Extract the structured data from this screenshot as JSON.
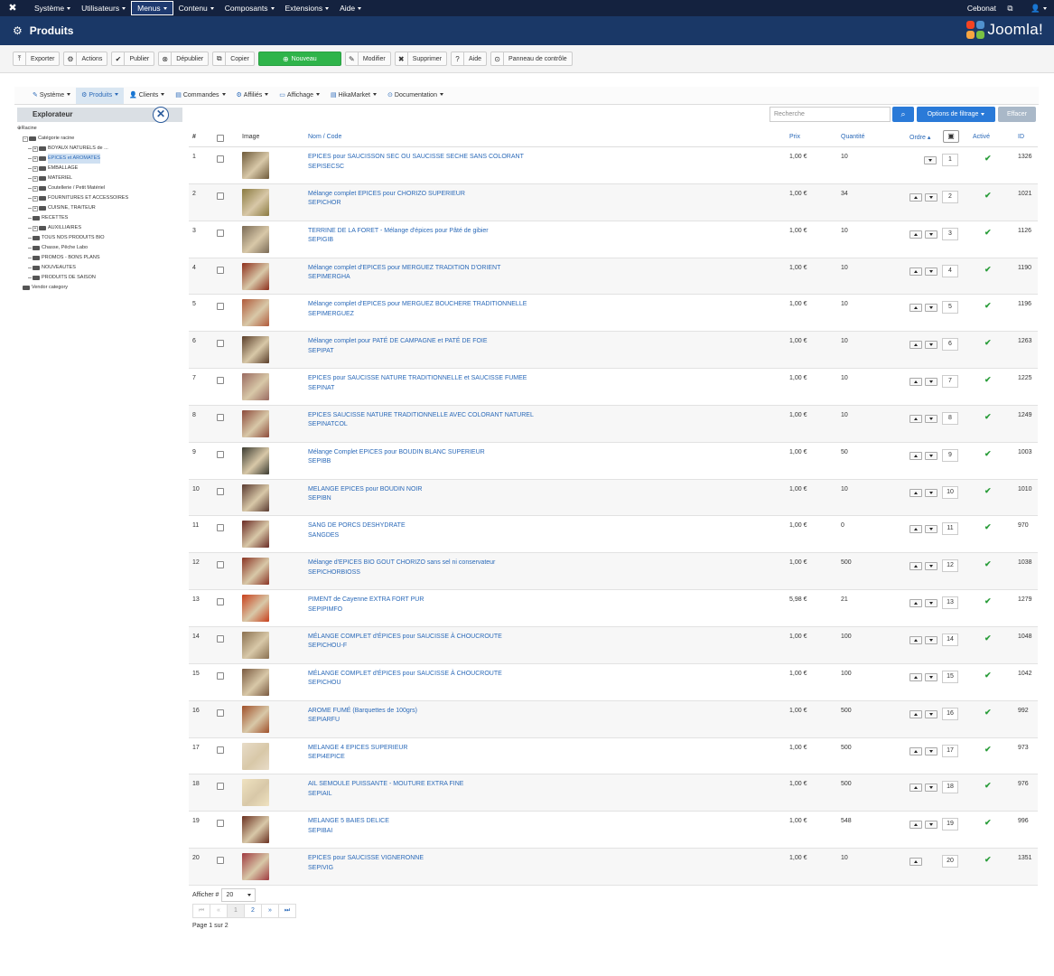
{
  "topnav": {
    "items": [
      {
        "label": "Système",
        "active": false
      },
      {
        "label": "Utilisateurs",
        "active": false
      },
      {
        "label": "Menus",
        "active": true
      },
      {
        "label": "Contenu",
        "active": false
      },
      {
        "label": "Composants",
        "active": false
      },
      {
        "label": "Extensions",
        "active": false
      },
      {
        "label": "Aide",
        "active": false
      }
    ],
    "site": "Cebonat",
    "user_glyph": "👤"
  },
  "title": "Produits",
  "brand": "Joomla!",
  "toolbar": [
    {
      "label": "Exporter",
      "icon": "⤒",
      "icon_name": "export-icon"
    },
    {
      "label": "Actions",
      "icon": "⚙",
      "icon_name": "actions-icon"
    },
    {
      "label": "Publier",
      "icon": "✔",
      "icon_name": "publish-icon"
    },
    {
      "label": "Dépublier",
      "icon": "⊗",
      "icon_name": "unpublish-icon"
    },
    {
      "label": "Copier",
      "icon": "⧉",
      "icon_name": "copy-icon"
    },
    {
      "label": "Nouveau",
      "icon": "⊕",
      "icon_name": "new-icon",
      "primary": true
    },
    {
      "label": "Modifier",
      "icon": "✎",
      "icon_name": "edit-icon"
    },
    {
      "label": "Supprimer",
      "icon": "✖",
      "icon_name": "delete-icon"
    },
    {
      "label": "Aide",
      "icon": "?",
      "icon_name": "help-icon"
    },
    {
      "label": "Panneau de contrôle",
      "icon": "⊙",
      "icon_name": "control-panel-icon"
    }
  ],
  "hikanav": [
    {
      "label": "Système",
      "icon": "✎",
      "icon_name": "wrench-icon",
      "active": false
    },
    {
      "label": "Produits",
      "icon": "⚙",
      "icon_name": "products-icon",
      "active": true
    },
    {
      "label": "Clients",
      "icon": "👤",
      "icon_name": "clients-icon",
      "active": false
    },
    {
      "label": "Commandes",
      "icon": "▤",
      "icon_name": "orders-icon",
      "active": false
    },
    {
      "label": "Affiliés",
      "icon": "⚙",
      "icon_name": "affiliates-icon",
      "active": false
    },
    {
      "label": "Affichage",
      "icon": "▭",
      "icon_name": "display-icon",
      "active": false
    },
    {
      "label": "HikaMarket",
      "icon": "▤",
      "icon_name": "hikamarket-icon",
      "active": false
    },
    {
      "label": "Documentation",
      "icon": "⊙",
      "icon_name": "documentation-icon",
      "active": false
    }
  ],
  "explorer": {
    "title": "Explorateur",
    "tree": [
      {
        "label": "Racine",
        "indent": 0,
        "exp": "",
        "selected": false
      },
      {
        "label": "Catégorie racine",
        "indent": 1,
        "exp": "−",
        "selected": false
      },
      {
        "label": "BOYAUX NATURELS de ...",
        "indent": 2,
        "exp": "+",
        "selected": false
      },
      {
        "label": "EPICES et AROMATES",
        "indent": 2,
        "exp": "+",
        "selected": true
      },
      {
        "label": "EMBALLAGE",
        "indent": 2,
        "exp": "+",
        "selected": false
      },
      {
        "label": "MATERIEL",
        "indent": 2,
        "exp": "+",
        "selected": false
      },
      {
        "label": "Coutellerie / Petit Matériel",
        "indent": 2,
        "exp": "+",
        "selected": false
      },
      {
        "label": "FOURNITURES ET ACCESSOIRES",
        "indent": 2,
        "exp": "+",
        "selected": false
      },
      {
        "label": "CUISINE, TRAITEUR",
        "indent": 2,
        "exp": "+",
        "selected": false
      },
      {
        "label": "RECETTES",
        "indent": 2,
        "exp": "",
        "selected": false
      },
      {
        "label": "AUXILLIAIRES",
        "indent": 2,
        "exp": "+",
        "selected": false
      },
      {
        "label": "TOUS NOS PRODUITS BIO",
        "indent": 2,
        "exp": "",
        "selected": false
      },
      {
        "label": "Chasse, Pêche Labo",
        "indent": 2,
        "exp": "",
        "selected": false
      },
      {
        "label": "PROMOS - BONS PLANS",
        "indent": 2,
        "exp": "",
        "selected": false
      },
      {
        "label": "NOUVEAUTES",
        "indent": 2,
        "exp": "",
        "selected": false
      },
      {
        "label": "PRODUITS DE SAISON",
        "indent": 2,
        "exp": "",
        "selected": false
      },
      {
        "label": "Vendor category",
        "indent": 1,
        "exp": "",
        "selected": false
      }
    ]
  },
  "filter": {
    "search_placeholder": "Recherche",
    "options_label": "Options de filtrage",
    "clear_label": "Effacer"
  },
  "table": {
    "headers": {
      "num": "#",
      "image": "Image",
      "name": "Nom / Code",
      "price": "Prix",
      "qty": "Quantité",
      "order": "Ordre",
      "active": "Activé",
      "id": "ID"
    },
    "rows": [
      {
        "n": "1",
        "name": "EPICES pour SAUCISSON SEC OU SAUCISSE SECHE SANS COLORANT",
        "code": "SEPISECSC",
        "price": "1,00 €",
        "qty": "10",
        "order": "1",
        "id": "1326",
        "img": "#6e5a3a"
      },
      {
        "n": "2",
        "name": "Mélange complet EPICES pour CHORIZO SUPERIEUR",
        "code": "SEPICHOR",
        "price": "1,00 €",
        "qty": "34",
        "order": "2",
        "id": "1021",
        "img": "#8a7a40"
      },
      {
        "n": "3",
        "name": "TERRINE DE LA FORET - Mélange d'épices pour Pâté de gibier",
        "code": "SEPIGIB",
        "price": "1,00 €",
        "qty": "10",
        "order": "3",
        "id": "1126",
        "img": "#7a6a55"
      },
      {
        "n": "4",
        "name": "Mélange complet d'EPICES pour MERGUEZ TRADITION D'ORIENT",
        "code": "SEPIMERGHA",
        "price": "1,00 €",
        "qty": "10",
        "order": "4",
        "id": "1190",
        "img": "#8e2f1c"
      },
      {
        "n": "5",
        "name": "Mélange complet d'EPICES pour MERGUEZ BOUCHERE TRADITIONNELLE",
        "code": "SEPIMERGUEZ",
        "price": "1,00 €",
        "qty": "10",
        "order": "5",
        "id": "1196",
        "img": "#b05a3a"
      },
      {
        "n": "6",
        "name": "Mélange complet pour PATÉ DE CAMPAGNE et PATÉ DE FOIE",
        "code": "SEPIPAT",
        "price": "1,00 €",
        "qty": "10",
        "order": "6",
        "id": "1263",
        "img": "#5a3e2a"
      },
      {
        "n": "7",
        "name": "EPICES pour SAUCISSE NATURE TRADITIONNELLE et SAUCISSE FUMEE",
        "code": "SEPINAT",
        "price": "1,00 €",
        "qty": "10",
        "order": "7",
        "id": "1225",
        "img": "#9a6a60"
      },
      {
        "n": "8",
        "name": "EPICES SAUCISSE NATURE TRADITIONNELLE AVEC COLORANT NATUREL",
        "code": "SEPINATCOL",
        "price": "1,00 €",
        "qty": "10",
        "order": "8",
        "id": "1249",
        "img": "#8c4a3a"
      },
      {
        "n": "9",
        "name": "Mélange Complet EPICES pour BOUDIN BLANC SUPERIEUR",
        "code": "SEPIBB",
        "price": "1,00 €",
        "qty": "50",
        "order": "9",
        "id": "1003",
        "img": "#3a3a30"
      },
      {
        "n": "10",
        "name": "MELANGE EPICES pour BOUDIN NOIR",
        "code": "SEPIBN",
        "price": "1,00 €",
        "qty": "10",
        "order": "10",
        "id": "1010",
        "img": "#5a3a30"
      },
      {
        "n": "11",
        "name": "SANG DE PORCS DESHYDRATE",
        "code": "SANGDES",
        "price": "1,00 €",
        "qty": "0",
        "order": "11",
        "id": "970",
        "img": "#6a2a24"
      },
      {
        "n": "12",
        "name": "Mélange d'EPICES BIO GOUT CHORIZO sans sel ni conservateur",
        "code": "SEPICHORBIOSS",
        "price": "1,00 €",
        "qty": "500",
        "order": "12",
        "id": "1038",
        "img": "#8a3424"
      },
      {
        "n": "13",
        "name": "PIMENT de Cayenne EXTRA FORT PUR",
        "code": "SEPIPIMFO",
        "price": "5,98 €",
        "qty": "21",
        "order": "13",
        "id": "1279",
        "img": "#c8401c"
      },
      {
        "n": "14",
        "name": "MÉLANGE COMPLET d'ÉPICES pour SAUCISSE À CHOUCROUTE",
        "code": "SEPICHOU-F",
        "price": "1,00 €",
        "qty": "100",
        "order": "14",
        "id": "1048",
        "img": "#8a7050"
      },
      {
        "n": "15",
        "name": "MÉLANGE COMPLET d'ÉPICES pour SAUCISSE À CHOUCROUTE",
        "code": "SEPICHOU",
        "price": "1,00 €",
        "qty": "100",
        "order": "15",
        "id": "1042",
        "img": "#7a5a40"
      },
      {
        "n": "16",
        "name": "AROME FUMÉ (Barquettes de 100grs)",
        "code": "SEPIARFU",
        "price": "1,00 €",
        "qty": "500",
        "order": "16",
        "id": "992",
        "img": "#a0502a"
      },
      {
        "n": "17",
        "name": "MELANGE 4 EPICES SUPERIEUR",
        "code": "SEPI4EPICE",
        "price": "1,00 €",
        "qty": "500",
        "order": "17",
        "id": "973",
        "img": "#e8dcc8"
      },
      {
        "n": "18",
        "name": "AIL SEMOULE PUISSANTE - MOUTURE EXTRA FINE",
        "code": "SEPIAIL",
        "price": "1,00 €",
        "qty": "500",
        "order": "18",
        "id": "976",
        "img": "#efe2c0"
      },
      {
        "n": "19",
        "name": "MELANGE 5 BAIES DELICE",
        "code": "SEPIBAI",
        "price": "1,00 €",
        "qty": "548",
        "order": "19",
        "id": "996",
        "img": "#6a3020"
      },
      {
        "n": "20",
        "name": "EPICES pour SAUCISSE VIGNERONNE",
        "code": "SEPIVIG",
        "price": "1,00 €",
        "qty": "10",
        "order": "20",
        "id": "1351",
        "img": "#a03a40"
      }
    ]
  },
  "pagination": {
    "limit_label": "Afficher #",
    "limit_value": "20",
    "buttons": [
      {
        "label": "⏮",
        "name": "first-page-button",
        "state": "dis"
      },
      {
        "label": "«",
        "name": "prev-page-button",
        "state": "dis"
      },
      {
        "label": "1",
        "name": "page-1-button",
        "state": "cur"
      },
      {
        "label": "2",
        "name": "page-2-button",
        "state": ""
      },
      {
        "label": "»",
        "name": "next-page-button",
        "state": ""
      },
      {
        "label": "⏭",
        "name": "last-page-button",
        "state": ""
      }
    ],
    "info": "Page 1 sur 2"
  },
  "colors": {
    "topnav": "#14223f",
    "titlebar": "#1a3867",
    "link": "#2a69b8",
    "primary": "#2a7ad8",
    "success": "#2fb44a"
  }
}
